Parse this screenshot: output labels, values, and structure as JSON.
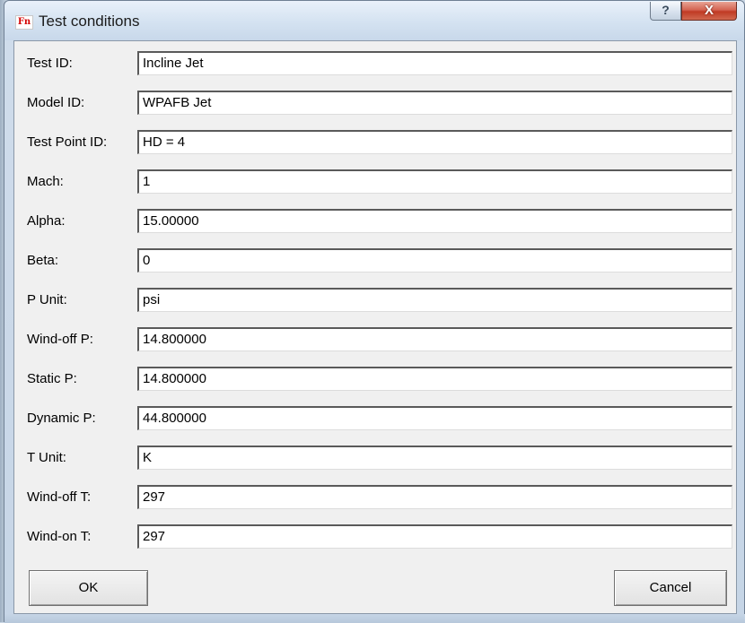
{
  "window": {
    "title": "Test conditions",
    "app_icon_text": "Fn",
    "help_button": "?",
    "close_button": "X"
  },
  "fields": [
    {
      "label": "Test ID:",
      "value": "Incline Jet"
    },
    {
      "label": "Model ID:",
      "value": "WPAFB Jet"
    },
    {
      "label": "Test Point ID:",
      "value": "HD = 4"
    },
    {
      "label": "Mach:",
      "value": "1"
    },
    {
      "label": "Alpha:",
      "value": "15.00000"
    },
    {
      "label": "Beta:",
      "value": "0"
    },
    {
      "label": "P Unit:",
      "value": "psi"
    },
    {
      "label": "Wind-off P:",
      "value": "14.800000"
    },
    {
      "label": "Static P:",
      "value": "14.800000"
    },
    {
      "label": "Dynamic P:",
      "value": "44.800000"
    },
    {
      "label": "T Unit:",
      "value": "K"
    },
    {
      "label": "Wind-off T:",
      "value": "297"
    },
    {
      "label": "Wind-on T:",
      "value": "297"
    }
  ],
  "buttons": {
    "ok": "OK",
    "cancel": "Cancel"
  }
}
